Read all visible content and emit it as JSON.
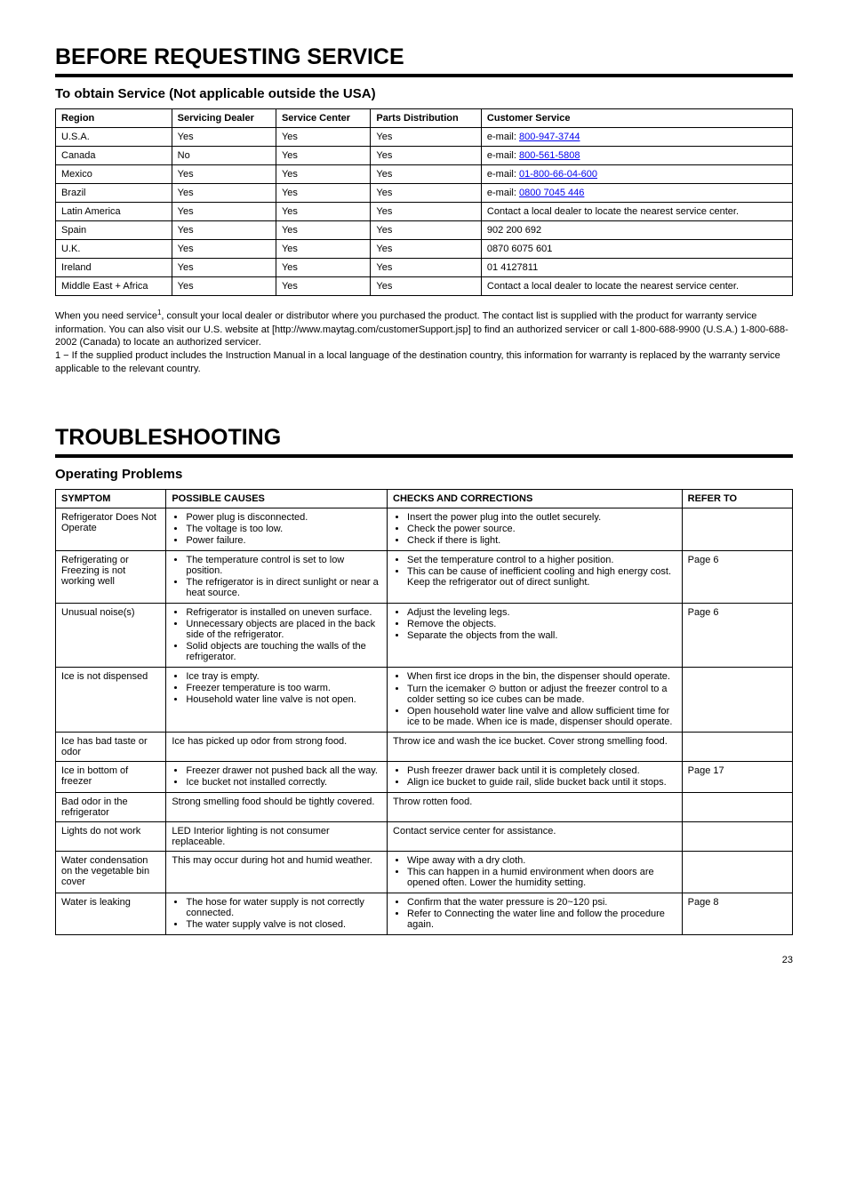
{
  "section1": {
    "title": "BEFORE REQUESTING SERVICE",
    "subtitle": "To obtain Service (Not applicable outside the USA)",
    "table": {
      "headers": [
        "Region",
        "Servicing Dealer",
        "Service Center",
        "Parts Distribution",
        "Customer Service"
      ],
      "rows": [
        {
          "region": "U.S.A.",
          "dealer": "Yes",
          "center": "Yes",
          "parts": "Yes",
          "email_label": "800-947-3744",
          "email_href": "mailto:800-947-3744"
        },
        {
          "region": "Canada",
          "dealer": "No",
          "center": "Yes",
          "parts": "Yes",
          "email_label": "800-561-5808",
          "email_href": "mailto:800-561-5808"
        },
        {
          "region": "Mexico",
          "dealer": "Yes",
          "center": "Yes",
          "parts": "Yes",
          "email_label": "01-800-66-04-600",
          "email_href": "mailto:01-800-66-04-600"
        },
        {
          "region": "Brazil",
          "dealer": "Yes",
          "center": "Yes",
          "parts": "Yes",
          "email_label": "0800 7045 446",
          "email_href": "mailto:0800%207045%20446"
        },
        {
          "region": "Latin America",
          "dealer": "Yes",
          "center": "Yes",
          "parts": "Yes",
          "customer": "Contact a local dealer to locate the nearest service center."
        },
        {
          "region": "Spain",
          "dealer": "Yes",
          "center": "Yes",
          "parts": "Yes",
          "customer": "902 200 692"
        },
        {
          "region": "U.K.",
          "dealer": "Yes",
          "center": "Yes",
          "parts": "Yes",
          "customer": "0870 6075 601"
        },
        {
          "region": "Ireland",
          "dealer": "Yes",
          "center": "Yes",
          "parts": "Yes",
          "customer": "01 4127811"
        },
        {
          "region": "Middle East + Africa",
          "dealer": "Yes",
          "center": "Yes",
          "parts": "Yes",
          "customer": "Contact a local dealer to locate the nearest service center."
        }
      ]
    },
    "note_html": "When you need service<sup>1</sup>, consult your local dealer or distributor where you purchased the product. The contact list is supplied with the product for warranty service information. You can also visit our U.S. website at [http://www.maytag.com/customerSupport.jsp] to find an authorized servicer or call 1-800-688-9900 (U.S.A.) 1-800-688-2002 (Canada) to locate an authorized servicer.<br>1 − If the supplied product includes the Instruction Manual in a local language of the destination country, this information for warranty is replaced by the warranty service applicable to the relevant country."
  },
  "section2": {
    "title": "TROUBLESHOOTING",
    "subtitle": "Operating Problems",
    "headers": [
      "SYMPTOM",
      "POSSIBLE CAUSES",
      "CHECKS AND CORRECTIONS",
      "REFER TO"
    ],
    "rows": [
      {
        "symptom": "Refrigerator Does Not Operate",
        "causes": [
          "Power plug is disconnected.",
          "The voltage is too low.",
          "Power failure."
        ],
        "checks": [
          "Insert the power plug into the outlet securely.",
          "Check the power source.",
          "Check if there is light."
        ],
        "ref": ""
      },
      {
        "symptom": "Refrigerating or Freezing is not working well",
        "causes": [
          "The temperature control is set to low position.",
          "The refrigerator is in direct sunlight or near a heat source."
        ],
        "checks": [
          "Set the temperature control to a higher position.",
          "This can be cause of inefficient cooling and high energy cost. Keep the refrigerator out of direct sunlight."
        ],
        "ref": "Page 6"
      },
      {
        "symptom": "Unusual noise(s)",
        "causes": [
          "Refrigerator is installed on uneven surface.",
          "Unnecessary objects are placed in the back side of the refrigerator.",
          "Solid objects are touching the walls of the refrigerator."
        ],
        "checks": [
          "Adjust the leveling legs.",
          "Remove the objects.",
          "Separate the objects from the wall."
        ],
        "ref": "Page 6"
      },
      {
        "symptom": "Ice is not dispensed",
        "causes": [
          "Ice tray is empty.",
          "Freezer temperature is too warm.",
          "Household water line valve is not open."
        ],
        "checks": [
          "When first ice drops in the bin, the dispenser should operate.",
          "Turn the icemaker ⊙ button or adjust the freezer control to a colder setting so ice cubes can be made.",
          "Open household water line valve and allow sufficient time for ice to be made. When ice is made, dispenser should operate."
        ],
        "ref": ""
      },
      {
        "symptom": "Ice has bad taste or odor",
        "causes": [
          "Ice has picked up odor from strong food."
        ],
        "checks": [
          "Throw ice and wash the ice bucket. Cover strong smelling food."
        ],
        "ref": ""
      },
      {
        "symptom": "Ice in bottom of freezer",
        "causes": [
          "Freezer drawer not pushed back all the way.",
          "Ice bucket not installed correctly."
        ],
        "checks": [
          "Push freezer drawer back until it is completely closed.",
          "Align ice bucket to guide rail, slide bucket back until it stops."
        ],
        "ref": "Page 17"
      },
      {
        "symptom": "Bad odor in the refrigerator",
        "causes": [
          "Strong smelling food should be tightly covered."
        ],
        "checks": [
          "Throw rotten food."
        ],
        "ref": ""
      },
      {
        "symptom": "Lights do not work",
        "causes": [
          "LED Interior lighting is not consumer replaceable."
        ],
        "checks": [
          "Contact service center for assistance."
        ],
        "ref": ""
      },
      {
        "symptom": "Water condensation on the vegetable bin cover",
        "causes": [
          "This may occur during hot and humid weather."
        ],
        "checks": [
          "Wipe away with a dry cloth.",
          "This can happen in a humid environment when doors are opened often. Lower the humidity setting."
        ],
        "ref": ""
      },
      {
        "symptom": "Water is leaking",
        "causes": [
          "The hose for water supply is not correctly connected.",
          "The water supply valve is not closed."
        ],
        "checks": [
          "Confirm that the water pressure is 20~120 psi.",
          "Refer to Connecting the water line and follow the procedure again."
        ],
        "ref": "Page 8"
      }
    ]
  },
  "page_number": "23"
}
